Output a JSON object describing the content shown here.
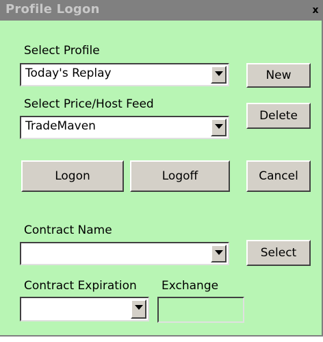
{
  "window": {
    "title": "Profile Logon",
    "close_label": "x"
  },
  "profile": {
    "label": "Select Profile",
    "value": "Today's Replay"
  },
  "feed": {
    "label": "Select Price/Host Feed",
    "value": "TradeMaven"
  },
  "buttons": {
    "new": "New",
    "delete": "Delete",
    "logon": "Logon",
    "logoff": "Logoff",
    "cancel": "Cancel",
    "select": "Select"
  },
  "contract": {
    "label": "Contract Name",
    "value": ""
  },
  "expiration": {
    "label": "Contract Expiration",
    "value": ""
  },
  "exchange": {
    "label": "Exchange",
    "value": ""
  },
  "colors": {
    "background": "#b8f5b4",
    "titlebar": "#808080",
    "button_face": "#d4d0c8"
  },
  "icons": {
    "dropdown": "triangle-down-icon",
    "close": "close-icon"
  }
}
